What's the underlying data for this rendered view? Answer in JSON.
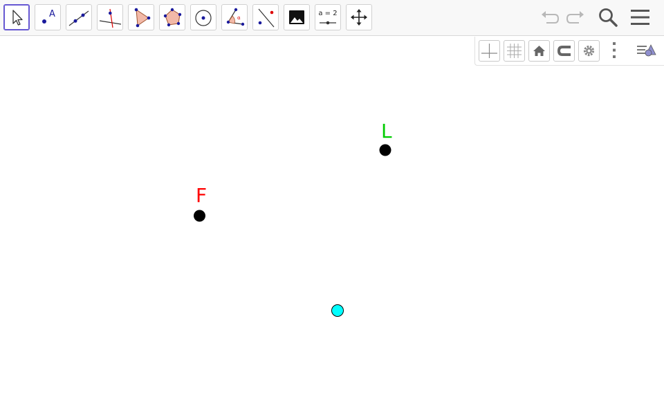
{
  "toolbar": {
    "tools": [
      {
        "id": "move",
        "icon": "arrow-pointer-icon",
        "selected": true
      },
      {
        "id": "point",
        "icon": "point-icon",
        "glyph": "A"
      },
      {
        "id": "line",
        "icon": "line-through-points-icon"
      },
      {
        "id": "perpendicular",
        "icon": "perpendicular-line-icon"
      },
      {
        "id": "polygon",
        "icon": "polygon-icon"
      },
      {
        "id": "regular-polygon",
        "icon": "regular-polygon-icon"
      },
      {
        "id": "circle",
        "icon": "circle-center-point-icon"
      },
      {
        "id": "angle",
        "icon": "angle-icon",
        "glyph": "α"
      },
      {
        "id": "reflect",
        "icon": "reflect-about-line-icon"
      },
      {
        "id": "image",
        "icon": "image-icon"
      },
      {
        "id": "slider",
        "icon": "slider-icon",
        "label": "a = 2"
      },
      {
        "id": "move-graphics",
        "icon": "move-graphics-view-icon"
      }
    ],
    "right": [
      "undo-icon",
      "redo-icon",
      "search-icon",
      "menu-icon"
    ]
  },
  "stylebar": {
    "buttons": [
      "axes-icon",
      "grid-icon",
      "home-icon",
      "point-capturing-icon",
      "settings-icon",
      "more-vertical-icon",
      "style-bar-toggle-icon"
    ]
  },
  "colors": {
    "accent": "#6557d2",
    "point_fill": "#000000",
    "label_L": "#00cc00",
    "label_F": "#ff0000",
    "free_point": "#00ffff",
    "tool_blue": "#1a1a9c",
    "polygon_fill": "#f2b9a8"
  },
  "canvas": {
    "points": [
      {
        "name": "L",
        "label": "L",
        "color": "#000000",
        "label_color": "#00cc00"
      },
      {
        "name": "F",
        "label": "F",
        "color": "#000000",
        "label_color": "#ff0000"
      },
      {
        "name": "unnamed",
        "label": "",
        "color": "#00ffff",
        "label_color": ""
      }
    ]
  }
}
